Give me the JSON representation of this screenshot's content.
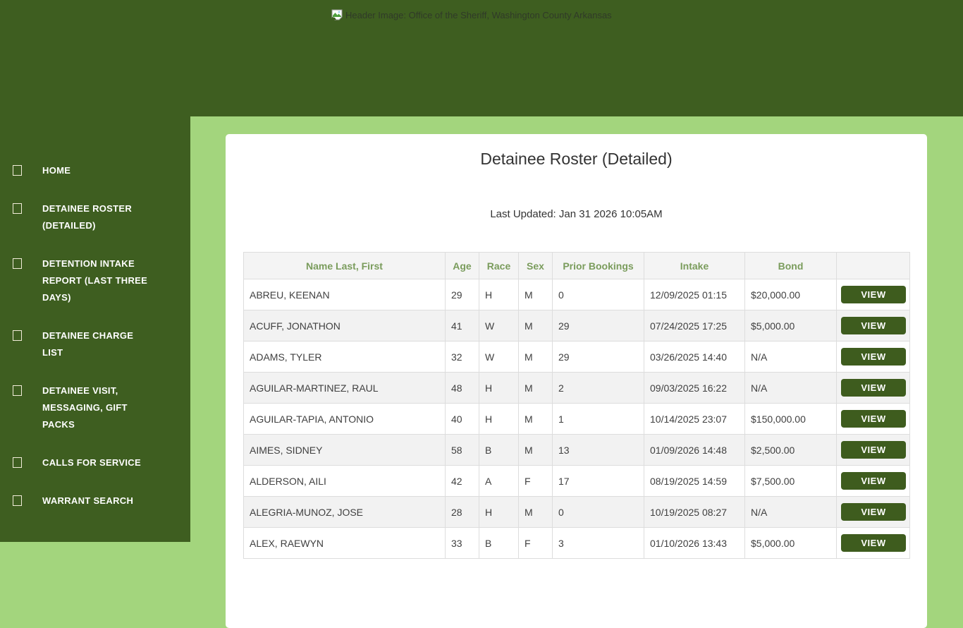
{
  "colors": {
    "dark_green": "#3e5e20",
    "light_green": "#a3d57d",
    "table_header_text": "#7a9c5c",
    "view_button_green": "#3e5c1e"
  },
  "header": {
    "alt_text": "Header Image: Office of the Sheriff, Washington County Arkansas"
  },
  "sidebar": {
    "items": [
      {
        "label": "HOME"
      },
      {
        "label": "DETAINEE ROSTER (DETAILED)"
      },
      {
        "label": "DETENTION INTAKE REPORT (LAST THREE DAYS)"
      },
      {
        "label": "DETAINEE CHARGE LIST"
      },
      {
        "label": "DETAINEE VISIT, MESSAGING, GIFT PACKS"
      },
      {
        "label": "CALLS FOR SERVICE"
      },
      {
        "label": "WARRANT SEARCH"
      }
    ]
  },
  "main": {
    "title": "Detainee Roster (Detailed)",
    "last_updated": "Last Updated: Jan 31 2026 10:05AM",
    "table": {
      "columns": [
        "Name Last, First",
        "Age",
        "Race",
        "Sex",
        "Prior Bookings",
        "Intake",
        "Bond",
        ""
      ],
      "view_label": "VIEW",
      "rows": [
        {
          "name": "ABREU, KEENAN",
          "age": "29",
          "race": "H",
          "sex": "M",
          "prior_bookings": "0",
          "intake": "12/09/2025 01:15",
          "bond": "$20,000.00"
        },
        {
          "name": "ACUFF, JONATHON",
          "age": "41",
          "race": "W",
          "sex": "M",
          "prior_bookings": "29",
          "intake": "07/24/2025 17:25",
          "bond": "$5,000.00"
        },
        {
          "name": "ADAMS, TYLER",
          "age": "32",
          "race": "W",
          "sex": "M",
          "prior_bookings": "29",
          "intake": "03/26/2025 14:40",
          "bond": "N/A"
        },
        {
          "name": "AGUILAR-MARTINEZ, RAUL",
          "age": "48",
          "race": "H",
          "sex": "M",
          "prior_bookings": "2",
          "intake": "09/03/2025 16:22",
          "bond": "N/A"
        },
        {
          "name": "AGUILAR-TAPIA, ANTONIO",
          "age": "40",
          "race": "H",
          "sex": "M",
          "prior_bookings": "1",
          "intake": "10/14/2025 23:07",
          "bond": "$150,000.00"
        },
        {
          "name": "AIMES, SIDNEY",
          "age": "58",
          "race": "B",
          "sex": "M",
          "prior_bookings": "13",
          "intake": "01/09/2026 14:48",
          "bond": "$2,500.00"
        },
        {
          "name": "ALDERSON, AILI",
          "age": "42",
          "race": "A",
          "sex": "F",
          "prior_bookings": "17",
          "intake": "08/19/2025 14:59",
          "bond": "$7,500.00"
        },
        {
          "name": "ALEGRIA-MUNOZ, JOSE",
          "age": "28",
          "race": "H",
          "sex": "M",
          "prior_bookings": "0",
          "intake": "10/19/2025 08:27",
          "bond": "N/A"
        },
        {
          "name": "ALEX, RAEWYN",
          "age": "33",
          "race": "B",
          "sex": "F",
          "prior_bookings": "3",
          "intake": "01/10/2026 13:43",
          "bond": "$5,000.00"
        }
      ]
    }
  }
}
